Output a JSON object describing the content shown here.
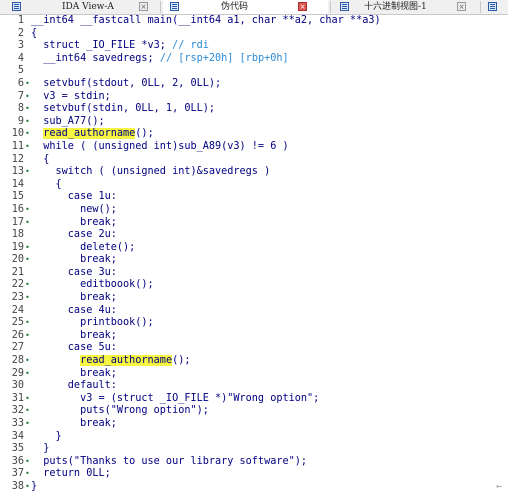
{
  "tabs": [
    {
      "label": "IDA View-A",
      "icon": "ida-view-icon",
      "close": "×",
      "active": false
    },
    {
      "label": "伪代码",
      "icon": "pseudocode-icon",
      "close": "×",
      "active": true
    },
    {
      "label": "十六进制视图-1",
      "icon": "hex-view-icon",
      "close": "×",
      "active": false
    },
    {
      "label": "",
      "icon": "structures-icon",
      "close": "",
      "active": false
    }
  ],
  "code_lines": [
    {
      "num": "1",
      "marker": "",
      "text": "__int64 __fastcall main(__int64 a1, char **a2, char **a3)"
    },
    {
      "num": "2",
      "marker": "",
      "text": "{"
    },
    {
      "num": "3",
      "marker": "",
      "text": "  struct _IO_FILE *v3; // rdi"
    },
    {
      "num": "4",
      "marker": "",
      "text": "  __int64 savedregs; // [rsp+20h] [rbp+0h]"
    },
    {
      "num": "5",
      "marker": "",
      "text": ""
    },
    {
      "num": "6",
      "marker": "•",
      "text": "  setvbuf(stdout, 0LL, 2, 0LL);"
    },
    {
      "num": "7",
      "marker": "•",
      "text": "  v3 = stdin;"
    },
    {
      "num": "8",
      "marker": "•",
      "text": "  setvbuf(stdin, 0LL, 1, 0LL);"
    },
    {
      "num": "9",
      "marker": "•",
      "text": "  sub_A77();"
    },
    {
      "num": "10",
      "marker": "•",
      "text": "  read_authorname();"
    },
    {
      "num": "11",
      "marker": "•",
      "text": "  while ( (unsigned int)sub_A89(v3) != 6 )"
    },
    {
      "num": "12",
      "marker": "",
      "text": "  {"
    },
    {
      "num": "13",
      "marker": "•",
      "text": "    switch ( (unsigned int)&savedregs )"
    },
    {
      "num": "14",
      "marker": "",
      "text": "    {"
    },
    {
      "num": "15",
      "marker": "",
      "text": "      case 1u:"
    },
    {
      "num": "16",
      "marker": "•",
      "text": "        new();"
    },
    {
      "num": "17",
      "marker": "•",
      "text": "        break;"
    },
    {
      "num": "18",
      "marker": "",
      "text": "      case 2u:"
    },
    {
      "num": "19",
      "marker": "•",
      "text": "        delete();"
    },
    {
      "num": "20",
      "marker": "•",
      "text": "        break;"
    },
    {
      "num": "21",
      "marker": "",
      "text": "      case 3u:"
    },
    {
      "num": "22",
      "marker": "•",
      "text": "        editboook();"
    },
    {
      "num": "23",
      "marker": "•",
      "text": "        break;"
    },
    {
      "num": "24",
      "marker": "",
      "text": "      case 4u:"
    },
    {
      "num": "25",
      "marker": "•",
      "text": "        printbook();"
    },
    {
      "num": "26",
      "marker": "•",
      "text": "        break;"
    },
    {
      "num": "27",
      "marker": "",
      "text": "      case 5u:"
    },
    {
      "num": "28",
      "marker": "•",
      "text": "        read_authorname();"
    },
    {
      "num": "29",
      "marker": "•",
      "text": "        break;"
    },
    {
      "num": "30",
      "marker": "",
      "text": "      default:"
    },
    {
      "num": "31",
      "marker": "•",
      "text": "        v3 = (struct _IO_FILE *)\"Wrong option\";"
    },
    {
      "num": "32",
      "marker": "•",
      "text": "        puts(\"Wrong option\");"
    },
    {
      "num": "33",
      "marker": "•",
      "text": "        break;"
    },
    {
      "num": "34",
      "marker": "",
      "text": "    }"
    },
    {
      "num": "35",
      "marker": "",
      "text": "  }"
    },
    {
      "num": "36",
      "marker": "•",
      "text": "  puts(\"Thanks to use our library software\");"
    },
    {
      "num": "37",
      "marker": "•",
      "text": "  return 0LL;"
    },
    {
      "num": "38",
      "marker": "•",
      "text": "}"
    }
  ],
  "highlights": [
    "read_authorname"
  ],
  "colors": {
    "code": "#000080",
    "comment": "#2c8bd6",
    "highlight": "#f5f542",
    "marker": "#1f7a3a"
  }
}
